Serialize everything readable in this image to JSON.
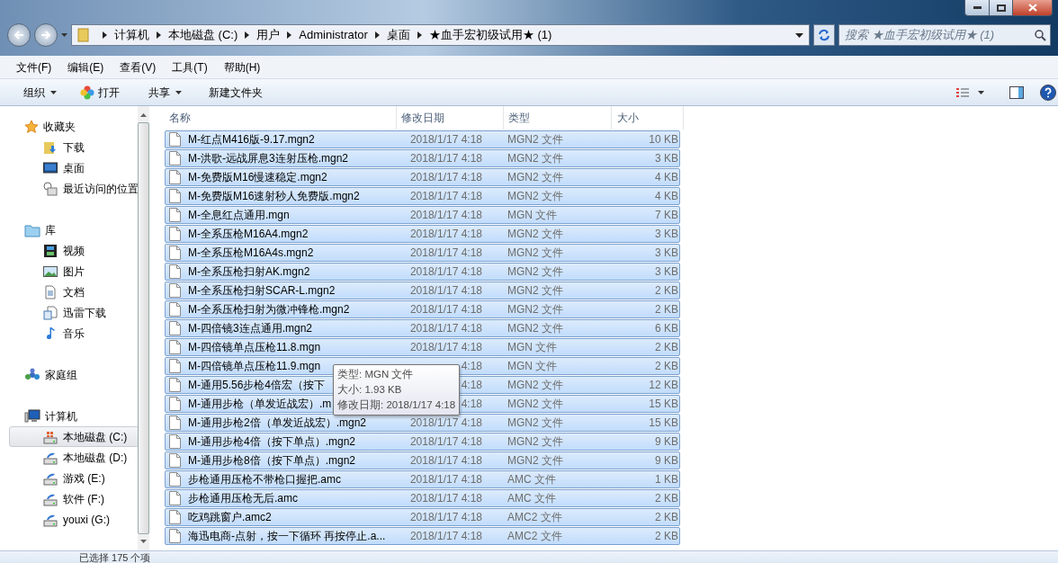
{
  "address_bar": {
    "crumbs": [
      "计算机",
      "本地磁盘 (C:)",
      "用户",
      "Administrator",
      "桌面",
      "★血手宏初级试用★ (1)"
    ]
  },
  "search": {
    "placeholder": "搜索 ★血手宏初级试用★ (1)"
  },
  "menu": [
    "文件(F)",
    "编辑(E)",
    "查看(V)",
    "工具(T)",
    "帮助(H)"
  ],
  "toolbar": {
    "organize": "组织",
    "open": "打开",
    "share": "共享",
    "new_folder": "新建文件夹"
  },
  "sidebar": {
    "groups": [
      {
        "kind": "favorites",
        "label": "收藏夹",
        "children": [
          {
            "kind": "download",
            "label": "下载",
            "selected": false
          },
          {
            "kind": "desktop",
            "label": "桌面",
            "selected": false
          },
          {
            "kind": "recent",
            "label": "最近访问的位置",
            "selected": false
          }
        ]
      },
      {
        "kind": "library",
        "label": "库",
        "children": [
          {
            "kind": "video",
            "label": "视频",
            "selected": false
          },
          {
            "kind": "picture",
            "label": "图片",
            "selected": false
          },
          {
            "kind": "document",
            "label": "文档",
            "selected": false
          },
          {
            "kind": "thunder",
            "label": "迅雷下载",
            "selected": false
          },
          {
            "kind": "music",
            "label": "音乐",
            "selected": false
          }
        ]
      },
      {
        "kind": "homegroup",
        "label": "家庭组"
      },
      {
        "kind": "computer",
        "label": "计算机",
        "children": [
          {
            "kind": "system_drive",
            "label": "本地磁盘 (C:)",
            "selected": true
          },
          {
            "kind": "drive",
            "label": "本地磁盘 (D:)",
            "selected": false
          },
          {
            "kind": "drive",
            "label": "游戏 (E:)",
            "selected": false
          },
          {
            "kind": "drive",
            "label": "软件 (F:)",
            "selected": false
          },
          {
            "kind": "drive",
            "label": "youxi (G:)",
            "selected": false
          }
        ]
      }
    ]
  },
  "table": {
    "columns": [
      "名称",
      "修改日期",
      "类型",
      "大小"
    ],
    "rows": [
      {
        "name": "M-红点M416版-9.17.mgn2",
        "date": "2018/1/17 4:18",
        "type": "MGN2 文件",
        "size": "10 KB",
        "selected": true
      },
      {
        "name": "M-洪歌-远战屏息3连射压枪.mgn2",
        "date": "2018/1/17 4:18",
        "type": "MGN2 文件",
        "size": "3 KB",
        "selected": true
      },
      {
        "name": "M-免费版M16慢速稳定.mgn2",
        "date": "2018/1/17 4:18",
        "type": "MGN2 文件",
        "size": "4 KB",
        "selected": true
      },
      {
        "name": "M-免费版M16速射秒人免费版.mgn2",
        "date": "2018/1/17 4:18",
        "type": "MGN2 文件",
        "size": "4 KB",
        "selected": true
      },
      {
        "name": "M-全息红点通用.mgn",
        "date": "2018/1/17 4:18",
        "type": "MGN 文件",
        "size": "7 KB",
        "selected": true
      },
      {
        "name": "M-全系压枪M16A4.mgn2",
        "date": "2018/1/17 4:18",
        "type": "MGN2 文件",
        "size": "3 KB",
        "selected": true
      },
      {
        "name": "M-全系压枪M16A4s.mgn2",
        "date": "2018/1/17 4:18",
        "type": "MGN2 文件",
        "size": "3 KB",
        "selected": true
      },
      {
        "name": "M-全系压枪扫射AK.mgn2",
        "date": "2018/1/17 4:18",
        "type": "MGN2 文件",
        "size": "3 KB",
        "selected": true
      },
      {
        "name": "M-全系压枪扫射SCAR-L.mgn2",
        "date": "2018/1/17 4:18",
        "type": "MGN2 文件",
        "size": "2 KB",
        "selected": true
      },
      {
        "name": "M-全系压枪扫射为微冲锋枪.mgn2",
        "date": "2018/1/17 4:18",
        "type": "MGN2 文件",
        "size": "2 KB",
        "selected": true
      },
      {
        "name": "M-四倍镜3连点通用.mgn2",
        "date": "2018/1/17 4:18",
        "type": "MGN2 文件",
        "size": "6 KB",
        "selected": true
      },
      {
        "name": "M-四倍镜单点压枪11.8.mgn",
        "date": "2018/1/17 4:18",
        "type": "MGN 文件",
        "size": "2 KB",
        "selected": true
      },
      {
        "name": "M-四倍镜单点压枪11.9.mgn",
        "date": "4:18",
        "type": "MGN 文件",
        "size": "2 KB",
        "selected": true
      },
      {
        "name": "M-通用5.56步枪4倍宏（按下",
        "date": "4:18",
        "type": "MGN2 文件",
        "size": "12 KB",
        "selected": true
      },
      {
        "name": "M-通用步枪（单发近战宏）.m",
        "date": "4:18",
        "type": "MGN2 文件",
        "size": "15 KB",
        "selected": true
      },
      {
        "name": "M-通用步枪2倍（单发近战宏）.mgn2",
        "date": "2018/1/17 4:18",
        "type": "MGN2 文件",
        "size": "15 KB",
        "selected": true
      },
      {
        "name": "M-通用步枪4倍（按下单点）.mgn2",
        "date": "2018/1/17 4:18",
        "type": "MGN2 文件",
        "size": "9 KB",
        "selected": true
      },
      {
        "name": "M-通用步枪8倍（按下单点）.mgn2",
        "date": "2018/1/17 4:18",
        "type": "MGN2 文件",
        "size": "9 KB",
        "selected": true
      },
      {
        "name": "步枪通用压枪不带枪口握把.amc",
        "date": "2018/1/17 4:18",
        "type": "AMC 文件",
        "size": "1 KB",
        "selected": true
      },
      {
        "name": "步枪通用压枪无后.amc",
        "date": "2018/1/17 4:18",
        "type": "AMC 文件",
        "size": "2 KB",
        "selected": true
      },
      {
        "name": "吃鸡跳窗户.amc2",
        "date": "2018/1/17 4:18",
        "type": "AMC2 文件",
        "size": "2 KB",
        "selected": true
      },
      {
        "name": "海迅电商-点射，按一下循环 再按停止.a...",
        "date": "2018/1/17 4:18",
        "type": "AMC2 文件",
        "size": "2 KB",
        "selected": true
      }
    ]
  },
  "tooltip": {
    "lines": [
      "类型: MGN 文件",
      "大小: 1.93 KB",
      "修改日期: 2018/1/17 4:18"
    ]
  },
  "status_bar": {
    "text": "已选择 175 个项"
  }
}
